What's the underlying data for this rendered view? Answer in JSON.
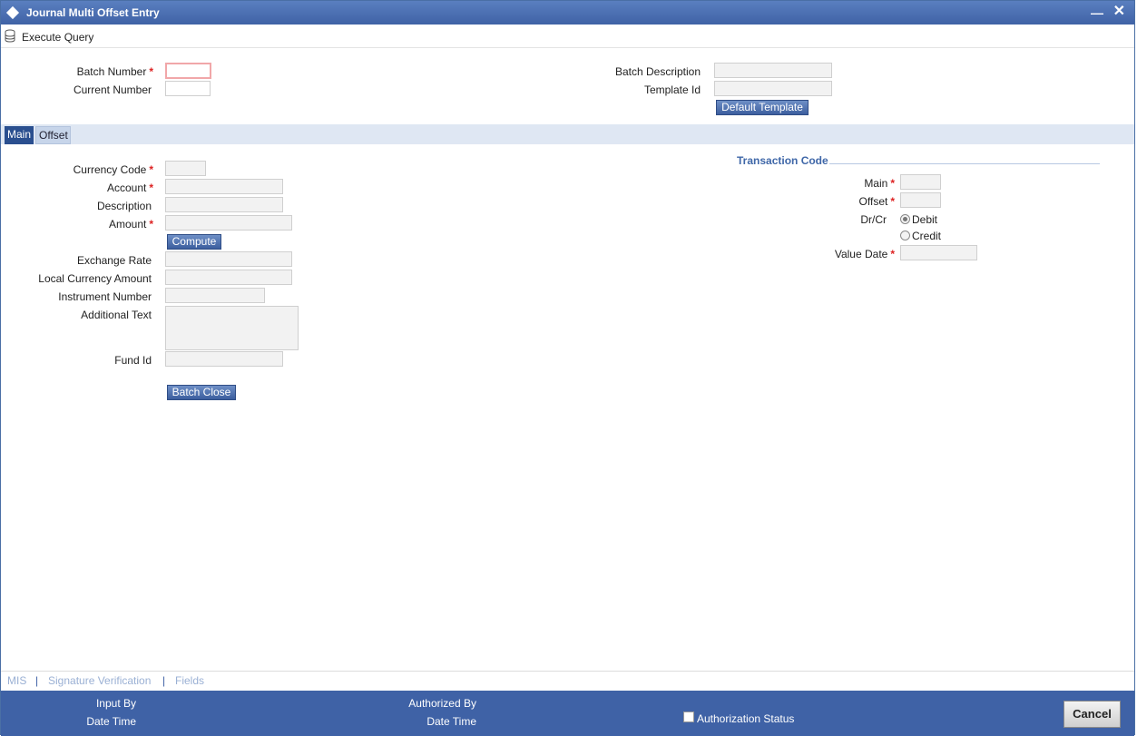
{
  "window": {
    "title": "Journal Multi Offset Entry"
  },
  "toolbar": {
    "execute_query": "Execute Query"
  },
  "header": {
    "batch_number_label": "Batch Number",
    "batch_number_value": "",
    "current_number_label": "Current Number",
    "current_number_value": "",
    "batch_description_label": "Batch Description",
    "template_id_label": "Template Id",
    "default_template_button": "Default Template"
  },
  "tabs": [
    {
      "label": "Main",
      "active": true
    },
    {
      "label": "Offset",
      "active": false
    }
  ],
  "main": {
    "currency_code_label": "Currency Code",
    "account_label": "Account",
    "description_label": "Description",
    "amount_label": "Amount",
    "compute_button": "Compute",
    "exchange_rate_label": "Exchange Rate",
    "local_currency_amount_label": "Local Currency Amount",
    "instrument_number_label": "Instrument Number",
    "additional_text_label": "Additional Text",
    "fund_id_label": "Fund Id",
    "batch_close_button": "Batch Close"
  },
  "transaction_code": {
    "title": "Transaction Code",
    "main_label": "Main",
    "offset_label": "Offset",
    "drcr_label": "Dr/Cr",
    "debit_label": "Debit",
    "credit_label": "Credit",
    "selected": "Debit",
    "value_date_label": "Value Date"
  },
  "required_marker": "*",
  "bottom_links": [
    "MIS",
    "Signature Verification",
    "Fields"
  ],
  "bottom_separator": "|",
  "footer": {
    "input_by_label": "Input By",
    "date_time_label_1": "Date Time",
    "authorized_by_label": "Authorized By",
    "date_time_label_2": "Date Time",
    "authorization_status_label": "Authorization Status",
    "cancel_button": "Cancel"
  },
  "colors": {
    "title_bar": "#3f62a6",
    "active_tab": "#2a4f8f",
    "tab_band": "#dfe7f3",
    "section_title": "#3f67a8",
    "required": "#dd2222"
  }
}
